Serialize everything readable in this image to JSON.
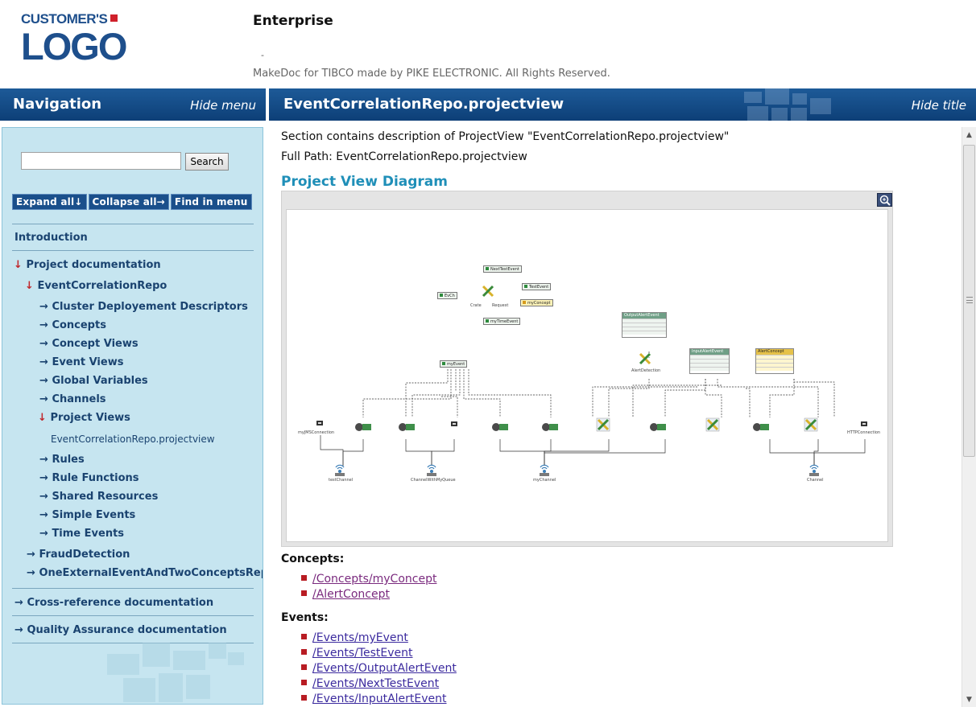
{
  "header": {
    "logo_top": "CUSTOMER'S",
    "logo_main": "LOGO",
    "title": "Enterprise",
    "dash": "-",
    "copyright": "MakeDoc for TIBCO made by PIKE ELECTRONIC. All Rights Reserved."
  },
  "nav_bar": {
    "title": "Navigation",
    "hide_label": "Hide menu"
  },
  "title_bar": {
    "title": "EventCorrelationRepo.projectview",
    "hide_label": "Hide title"
  },
  "sidebar": {
    "search_value": "",
    "search_button": "Search",
    "buttons": {
      "expand": "Expand all↓",
      "collapse": "Collapse all→",
      "find": "Find in menu"
    },
    "introduction": "Introduction",
    "project_doc": "Project documentation",
    "repo": "EventCorrelationRepo",
    "items": [
      "Cluster Deployement Descriptors",
      "Concepts",
      "Concept Views",
      "Event Views",
      "Global Variables",
      "Channels"
    ],
    "project_views": "Project Views",
    "current_view": "EventCorrelationRepo.projectview",
    "items_after": [
      "Rules",
      "Rule Functions",
      "Shared Resources",
      "Simple Events",
      "Time Events"
    ],
    "fraud": "FraudDetection",
    "one_external": "OneExternalEventAndTwoConceptsRepo",
    "cross_ref": "Cross-reference documentation",
    "qa": "Quality Assurance documentation"
  },
  "content": {
    "desc": "Section contains description of ProjectView \"EventCorrelationRepo.projectview\"",
    "full_path": "Full Path: EventCorrelationRepo.projectview",
    "diagram_heading": "Project View Diagram",
    "concepts_heading": "Concepts:",
    "concepts": [
      "/Concepts/myConcept",
      "/AlertConcept"
    ],
    "events_heading": "Events:",
    "events": [
      "/Events/myEvent",
      "/Events/TestEvent",
      "/Events/OutputAlertEvent",
      "/Events/NextTestEvent",
      "/Events/InputAlertEvent"
    ]
  },
  "diagram": {
    "tags": {
      "next_test_event": "NextTestEvent",
      "test_event": "TestEvent",
      "my_concept": "myConcept",
      "evch": "EvCh",
      "my_time_event": "myTimeEvent",
      "my_event": "myEvent"
    },
    "boxes": {
      "output_alert": "OutputAlertEvent",
      "input_alert": "InputAlertEvent",
      "alert_concept": "AlertConcept"
    },
    "labels": {
      "rule_a": "Crate",
      "rule_b": "Request",
      "alert_rule": "AlertDetection",
      "chan1": "testChannel",
      "chan2": "ChannelWithMyQueue",
      "chan3": "myChannel",
      "chan4": "Channel",
      "conn_left": "myJMSConnection",
      "conn_right": "HTTPConnection"
    }
  },
  "colors": {
    "bar_blue": "#0d3f77",
    "sidebar_bg": "#c6e5f0",
    "heading_teal": "#1f8fb8",
    "bullet_red": "#b81c23"
  }
}
